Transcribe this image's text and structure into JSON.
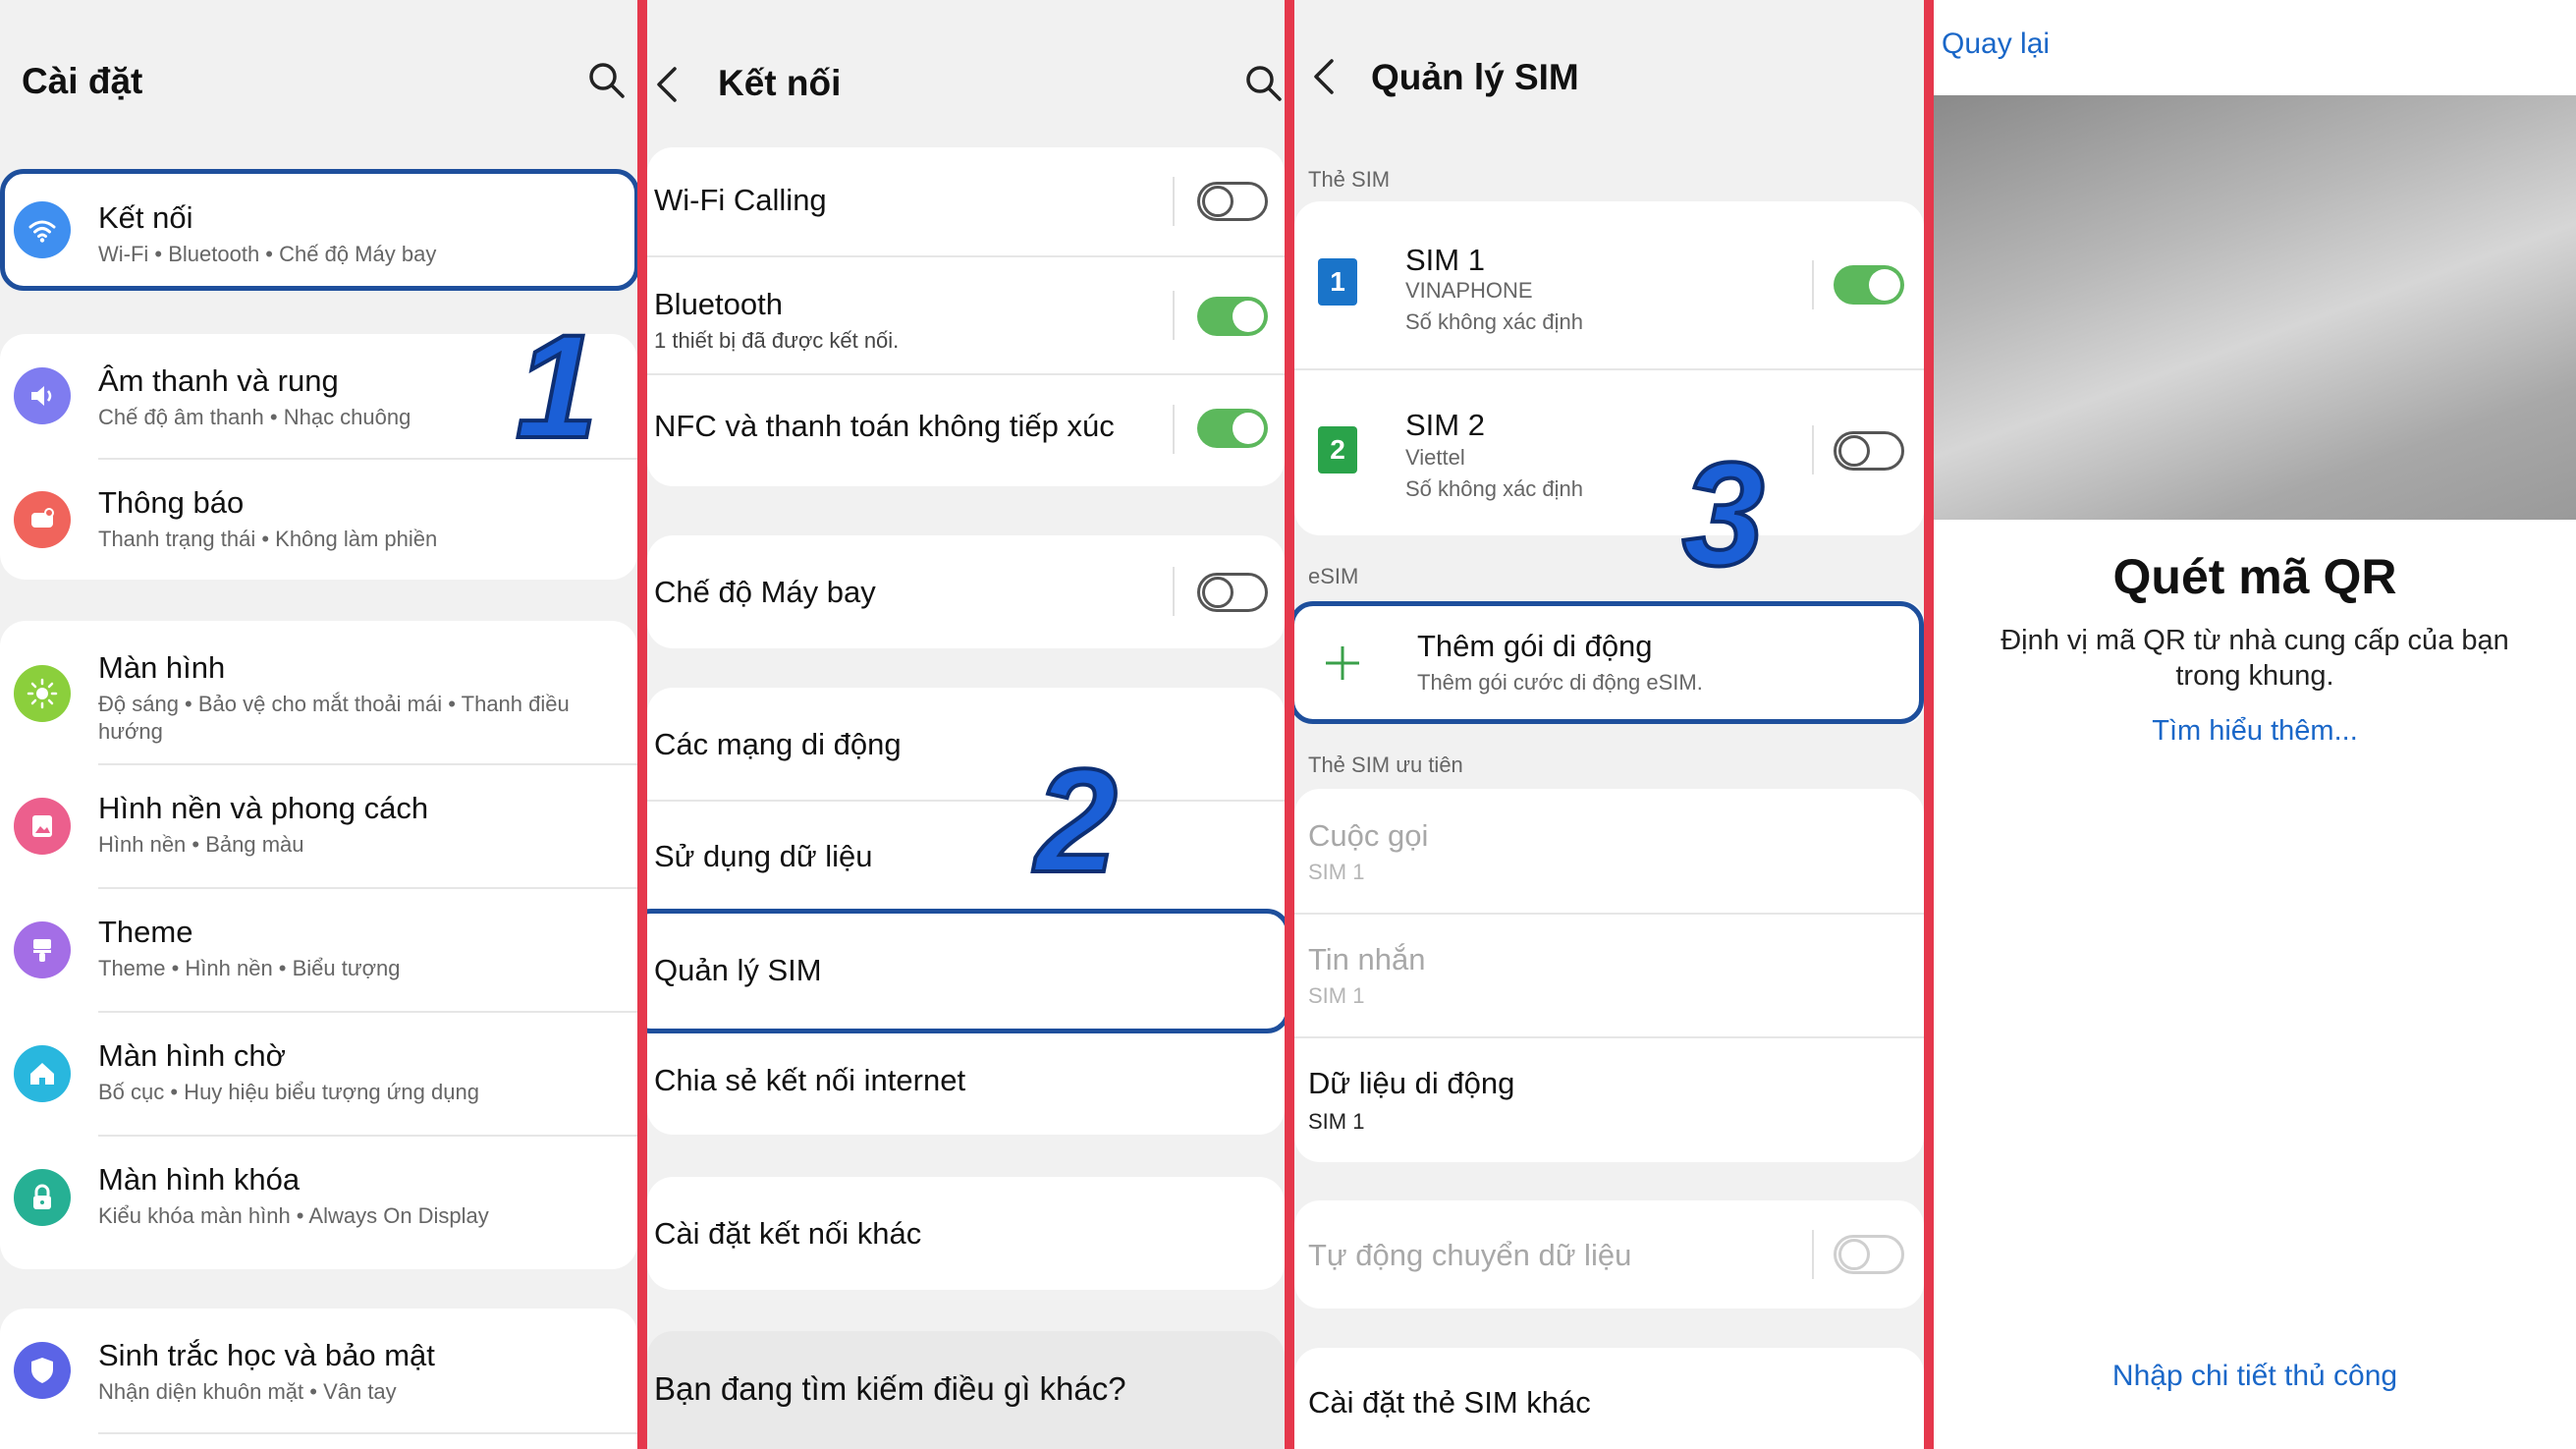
{
  "panel1": {
    "title": "Cài đặt",
    "items": [
      {
        "title": "Kết nối",
        "sub": "Wi-Fi  •  Bluetooth  •  Chế độ Máy bay"
      },
      {
        "title": "Âm thanh và rung",
        "sub": "Chế độ âm thanh  •  Nhạc chuông"
      },
      {
        "title": "Thông báo",
        "sub": "Thanh trạng thái  •  Không làm phiền"
      },
      {
        "title": "Màn hình",
        "sub": "Độ sáng  •  Bảo vệ cho mắt thoải mái  •  Thanh điều",
        "sub2": "hướng"
      },
      {
        "title": "Hình nền và phong cách",
        "sub": "Hình nền  •  Bảng màu"
      },
      {
        "title": "Theme",
        "sub": "Theme  •  Hình nền  •  Biểu tượng"
      },
      {
        "title": "Màn hình chờ",
        "sub": "Bố cục  •  Huy hiệu biểu tượng ứng dụng"
      },
      {
        "title": "Màn hình khóa",
        "sub": "Kiểu khóa màn hình  •  Always On Display"
      },
      {
        "title": "Sinh trắc học và bảo mật",
        "sub": "Nhận diện khuôn mặt  •  Vân tay"
      }
    ],
    "step": "1"
  },
  "panel2": {
    "title": "Kết nối",
    "items": [
      {
        "title": "Wi-Fi Calling",
        "toggle": "off"
      },
      {
        "title": "Bluetooth",
        "sub": "1 thiết bị đã được kết nối.",
        "toggle": "on"
      },
      {
        "title": "NFC và thanh toán không tiếp xúc",
        "toggle": "on"
      },
      {
        "title": "Chế độ Máy bay",
        "toggle": "off"
      },
      {
        "title": "Các mạng di động"
      },
      {
        "title": "Sử dụng dữ liệu"
      },
      {
        "title": "Quản lý SIM"
      },
      {
        "title": "Chia sẻ kết nối internet"
      },
      {
        "title": "Cài đặt kết nối khác"
      },
      {
        "title": "Bạn đang tìm kiếm điều gì khác?"
      }
    ],
    "step": "2"
  },
  "panel3": {
    "title": "Quản lý SIM",
    "section_sim": "Thẻ SIM",
    "sim1": {
      "badge": "1",
      "title": "SIM 1",
      "carrier": "VINAPHONE",
      "number": "Số không xác định",
      "toggle": "on",
      "color": "#1a74c9"
    },
    "sim2": {
      "badge": "2",
      "title": "SIM 2",
      "carrier": "Viettel",
      "number": "Số không xác định",
      "toggle": "off",
      "color": "#2aa34a"
    },
    "section_esim": "eSIM",
    "esim": {
      "title": "Thêm gói di động",
      "sub": "Thêm gói cước di động eSIM."
    },
    "section_pref": "Thẻ SIM ưu tiên",
    "pref": [
      {
        "title": "Cuộc gọi",
        "sub": "SIM 1"
      },
      {
        "title": "Tin nhắn",
        "sub": "SIM 1"
      },
      {
        "title": "Dữ liệu di động",
        "sub": "SIM 1"
      }
    ],
    "auto_switch": "Tự động chuyển dữ liệu",
    "other": "Cài đặt thẻ SIM khác",
    "step": "3"
  },
  "panel4": {
    "back": "Quay lại",
    "title": "Quét mã QR",
    "desc1": "Định vị mã QR từ nhà cung cấp của bạn",
    "desc2": "trong khung.",
    "learn_more": "Tìm hiểu thêm...",
    "manual": "Nhập chi tiết thủ công"
  },
  "colors": {
    "accent_blue": "#1e4f9c",
    "toggle_on": "#5cb85c",
    "divider_red": "#e5384c",
    "link_blue": "#1a67c8"
  }
}
